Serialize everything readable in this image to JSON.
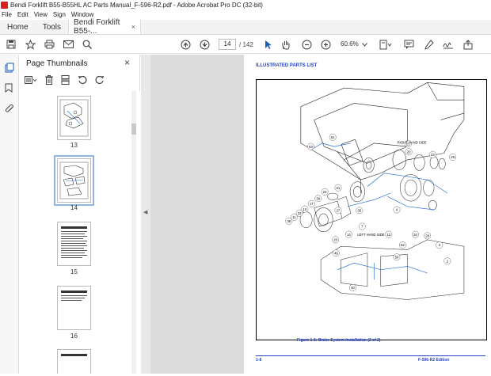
{
  "window": {
    "title": "Bendi Forklift B55-B55HL AC Parts Manual_F-596-R2.pdf - Adobe Acrobat Pro DC (32-bit)"
  },
  "menu": [
    "File",
    "Edit",
    "View",
    "Sign",
    "Window"
  ],
  "tabs": {
    "home": "Home",
    "tools": "Tools",
    "document": "Bendi Forklift B55-...",
    "close": "×"
  },
  "toolbar": {
    "current_page": "14",
    "total_pages": "/ 142",
    "zoom": "60.6%"
  },
  "panel": {
    "title": "Page Thumbnails",
    "close": "×",
    "thumbnails": [
      {
        "label": "13"
      },
      {
        "label": "14"
      },
      {
        "label": "15"
      },
      {
        "label": "16"
      }
    ]
  },
  "page": {
    "heading": "ILLUSTRATED PARTS LIST",
    "right_label": "RIGHT HAND SIDE",
    "left_label": "LEFT HAND SIDE",
    "caption": "Figure 1-5:  Brake System Installation (2 of 2)",
    "page_no": "1-8",
    "edition": "F-596-R2 Edition",
    "callouts": [
      "53",
      "51",
      "21",
      "20",
      "23",
      "25",
      "38",
      "27",
      "22",
      "30",
      "21",
      "11",
      "33",
      "10",
      "17",
      "7",
      "8",
      "14",
      "13",
      "12",
      "4",
      "29",
      "34",
      "28",
      "3",
      "2",
      "1",
      "14",
      "15",
      "16",
      "50",
      "52",
      "49",
      "50",
      "50"
    ]
  },
  "colors": {
    "accent_blue": "#2244cc",
    "acrobat_red": "#d6221b"
  }
}
